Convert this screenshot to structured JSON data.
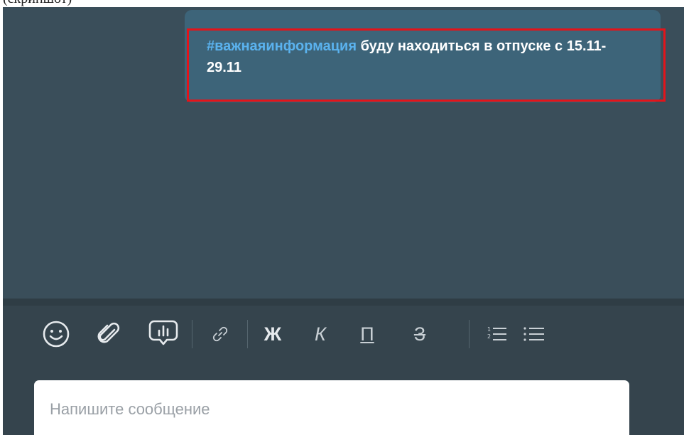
{
  "top_caption": "(скриншот)",
  "message": {
    "hashtag": "#важнаяинформация",
    "text": " буду находиться в отпуске с 15.11-29.11"
  },
  "toolbar": {
    "bold_label": "Ж",
    "italic_label": "К",
    "underline_label": "П",
    "strike_label": "З"
  },
  "composer": {
    "placeholder": "Напишите сообщение"
  },
  "colors": {
    "chat_background": "#3a4e5a",
    "bubble": "#3d6479",
    "hashtag": "#5ab2ee",
    "highlight": "#e3141a"
  }
}
